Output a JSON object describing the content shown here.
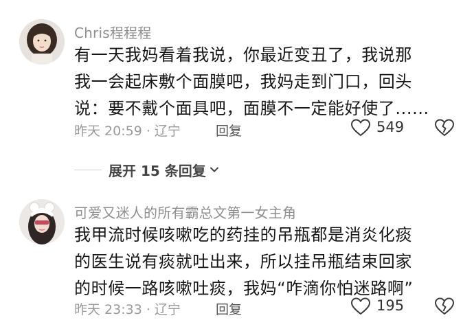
{
  "comments": [
    {
      "username": "Chris程程程",
      "lines": [
        "有一天我妈看着我说，你最近变丑了，我说那",
        "我一会起床敷个面膜吧，我妈走到门口，回头",
        "说：要不戴个面具吧，面膜不一定能好使了......"
      ],
      "time": "昨天 20:59 · 辽宁",
      "reply_label": "回复",
      "likes": "549"
    },
    {
      "username": "可爱又迷人的所有霸总文第一女主角",
      "lines": [
        "我甲流时候咳嗽吃的药挂的吊瓶都是消炎化痰",
        "的医生说有痰就吐出来，所以挂吊瓶结束回家",
        "的时候一路咳嗽吐痰，我妈“咋滴你怕迷路啊”"
      ],
      "time": "昨天 23:33 · 辽宁",
      "reply_label": "回复",
      "likes": "195"
    }
  ],
  "expand_replies": {
    "label": "展开 15 条回复"
  },
  "icons": {
    "like": "heart-outline-icon",
    "dislike": "broken-heart-icon",
    "expand": "chevron-down-icon"
  },
  "colors": {
    "text_primary": "#161616",
    "text_secondary": "#8f8f8f",
    "background": "#ffffff"
  }
}
